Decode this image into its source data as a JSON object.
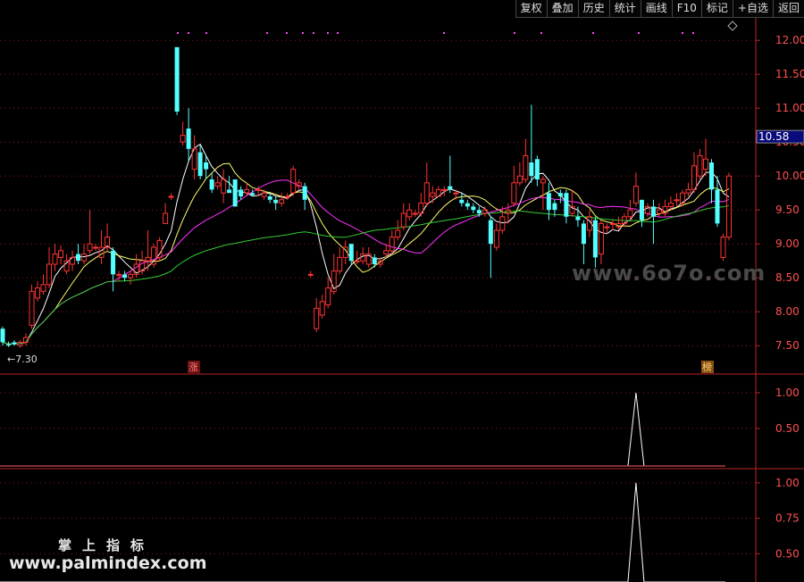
{
  "toolbar": {
    "items": [
      "复权",
      "叠加",
      "历史",
      "统计",
      "画线",
      "F10",
      "标记",
      "+自选",
      "返回"
    ]
  },
  "chart_data": {
    "type": "candlestick",
    "main_panel": {
      "y_ticks": [
        "12.00",
        "11.50",
        "11.00",
        "10.50",
        "10.00",
        "9.50",
        "9.00",
        "8.50",
        "8.00",
        "7.50"
      ],
      "ylim": [
        7.2,
        12.2
      ],
      "current_price_label": "10.58",
      "low_label": "←7.30",
      "marker_zhang": "涨",
      "marker_bang": "榜",
      "ma_colors": [
        "#ffffff",
        "#ffff66",
        "#ff33ff",
        "#33cc33"
      ],
      "candles": [
        [
          7.75,
          7.55,
          7.78,
          7.5
        ],
        [
          7.52,
          7.5,
          7.56,
          7.48
        ],
        [
          7.55,
          7.52,
          7.58,
          7.5
        ],
        [
          7.5,
          7.55,
          7.58,
          7.47
        ],
        [
          7.55,
          7.62,
          7.68,
          7.5
        ],
        [
          7.8,
          8.3,
          8.4,
          7.75
        ],
        [
          8.2,
          8.35,
          8.45,
          8.15
        ],
        [
          8.3,
          8.4,
          8.55,
          8.25
        ],
        [
          8.4,
          8.7,
          8.95,
          8.35
        ],
        [
          8.7,
          8.85,
          9.0,
          8.6
        ],
        [
          8.8,
          8.9,
          8.98,
          8.7
        ],
        [
          8.6,
          8.75,
          8.85,
          8.55
        ],
        [
          8.7,
          8.8,
          8.9,
          8.6
        ],
        [
          8.85,
          8.75,
          9.0,
          8.7
        ],
        [
          8.75,
          8.85,
          9.0,
          8.7
        ],
        [
          8.9,
          9.0,
          9.5,
          8.85
        ],
        [
          8.95,
          8.95,
          9.0,
          8.9
        ],
        [
          8.8,
          8.95,
          9.2,
          8.7
        ],
        [
          8.95,
          9.1,
          9.3,
          8.9
        ],
        [
          8.9,
          8.55,
          8.95,
          8.3
        ],
        [
          8.55,
          8.55,
          8.6,
          8.45
        ],
        [
          8.55,
          8.5,
          8.6,
          8.45
        ],
        [
          8.5,
          8.55,
          8.6,
          8.4
        ],
        [
          8.55,
          8.7,
          8.85,
          8.5
        ],
        [
          8.6,
          8.75,
          8.9,
          8.55
        ],
        [
          8.75,
          8.8,
          9.2,
          8.6
        ],
        [
          8.7,
          8.95,
          9.0,
          8.65
        ],
        [
          8.8,
          9.05,
          9.1,
          8.75
        ],
        [
          9.3,
          9.45,
          9.6,
          9.3
        ],
        [
          9.7,
          9.7,
          9.75,
          9.65
        ],
        [
          11.9,
          10.95,
          11.9,
          10.9
        ],
        [
          10.5,
          10.6,
          10.8,
          10.45
        ],
        [
          10.7,
          10.4,
          11.0,
          10.2
        ],
        [
          10.1,
          10.4,
          10.6,
          9.95
        ],
        [
          10.35,
          10.0,
          10.45,
          9.95
        ],
        [
          10.2,
          10.1,
          10.3,
          9.95
        ],
        [
          9.95,
          9.8,
          10.05,
          9.75
        ],
        [
          9.85,
          9.9,
          10.0,
          9.8
        ],
        [
          9.75,
          9.95,
          10.1,
          9.6
        ],
        [
          9.8,
          9.75,
          10.0,
          9.75
        ],
        [
          9.95,
          9.55,
          9.95,
          9.55
        ],
        [
          9.8,
          9.7,
          9.85,
          9.65
        ],
        [
          9.75,
          9.8,
          9.9,
          9.7
        ],
        [
          9.75,
          9.72,
          9.8,
          9.7
        ],
        [
          9.8,
          9.8,
          9.85,
          9.7
        ],
        [
          9.7,
          9.75,
          9.8,
          9.65
        ],
        [
          9.7,
          9.65,
          9.75,
          9.6
        ],
        [
          9.65,
          9.6,
          9.7,
          9.5
        ],
        [
          9.6,
          9.65,
          9.75,
          9.55
        ],
        [
          9.7,
          9.7,
          9.75,
          9.65
        ],
        [
          9.75,
          10.1,
          10.15,
          9.7
        ],
        [
          9.85,
          9.9,
          9.95,
          9.8
        ],
        [
          9.85,
          9.65,
          9.9,
          9.5
        ],
        [
          8.55,
          8.55,
          8.6,
          8.5
        ],
        [
          7.75,
          8.05,
          8.2,
          7.7
        ],
        [
          7.95,
          8.15,
          8.25,
          7.9
        ],
        [
          8.1,
          8.35,
          8.5,
          8.05
        ],
        [
          8.3,
          8.6,
          8.85,
          8.25
        ],
        [
          8.6,
          8.8,
          8.95,
          8.55
        ],
        [
          8.8,
          8.95,
          9.05,
          8.7
        ],
        [
          9.0,
          8.75,
          9.0,
          8.7
        ],
        [
          8.75,
          8.75,
          8.9,
          8.7
        ],
        [
          8.75,
          8.85,
          8.95,
          8.7
        ],
        [
          8.7,
          8.85,
          8.95,
          8.65
        ],
        [
          8.8,
          8.7,
          8.85,
          8.65
        ],
        [
          8.7,
          8.75,
          8.8,
          8.65
        ],
        [
          8.85,
          8.9,
          9.0,
          8.8
        ],
        [
          8.9,
          9.1,
          9.2,
          8.85
        ],
        [
          9.1,
          9.2,
          9.35,
          9.05
        ],
        [
          9.25,
          9.45,
          9.6,
          9.2
        ],
        [
          9.4,
          9.5,
          9.6,
          9.35
        ],
        [
          9.45,
          9.45,
          9.5,
          9.4
        ],
        [
          9.45,
          9.6,
          9.75,
          9.4
        ],
        [
          9.6,
          9.9,
          10.2,
          9.55
        ],
        [
          9.7,
          9.75,
          9.85,
          9.6
        ],
        [
          9.7,
          9.8,
          9.85,
          9.7
        ],
        [
          9.8,
          9.8,
          9.85,
          9.7
        ],
        [
          9.85,
          9.8,
          10.3,
          9.75
        ],
        [
          9.75,
          9.75,
          9.8,
          9.65
        ],
        [
          9.65,
          9.6,
          9.75,
          9.55
        ],
        [
          9.6,
          9.55,
          9.65,
          9.5
        ],
        [
          9.55,
          9.5,
          9.6,
          9.45
        ],
        [
          9.5,
          9.45,
          9.55,
          9.4
        ],
        [
          9.45,
          9.5,
          9.55,
          9.4
        ],
        [
          9.35,
          9.0,
          9.4,
          8.5
        ],
        [
          8.95,
          9.2,
          9.3,
          8.9
        ],
        [
          9.2,
          9.4,
          9.55,
          9.15
        ],
        [
          9.45,
          9.5,
          9.6,
          9.3
        ],
        [
          9.6,
          9.9,
          10.15,
          9.55
        ],
        [
          9.9,
          10.0,
          10.2,
          9.85
        ],
        [
          9.95,
          10.3,
          10.55,
          9.9
        ],
        [
          10.2,
          10.0,
          11.05,
          9.9
        ],
        [
          10.25,
          9.95,
          10.3,
          9.85
        ],
        [
          9.9,
          9.95,
          10.0,
          9.5
        ],
        [
          9.75,
          9.5,
          9.9,
          9.35
        ],
        [
          9.6,
          9.5,
          9.65,
          9.4
        ],
        [
          9.75,
          9.7,
          9.8,
          9.6
        ],
        [
          9.75,
          9.4,
          9.8,
          9.3
        ],
        [
          9.45,
          9.55,
          9.8,
          9.4
        ],
        [
          9.4,
          9.35,
          9.55,
          9.25
        ],
        [
          9.3,
          9.0,
          9.35,
          8.7
        ],
        [
          9.2,
          9.4,
          9.5,
          9.1
        ],
        [
          9.35,
          8.8,
          9.4,
          8.65
        ],
        [
          8.85,
          9.3,
          9.35,
          8.7
        ],
        [
          9.25,
          9.25,
          9.3,
          9.15
        ],
        [
          9.3,
          9.3,
          9.35,
          9.2
        ],
        [
          9.25,
          9.3,
          9.4,
          9.2
        ],
        [
          9.3,
          9.4,
          9.45,
          9.25
        ],
        [
          9.4,
          9.5,
          9.65,
          9.35
        ],
        [
          9.6,
          9.85,
          10.05,
          9.55
        ],
        [
          9.65,
          9.35,
          9.65,
          9.25
        ],
        [
          9.45,
          9.55,
          9.6,
          9.4
        ],
        [
          9.55,
          9.4,
          9.65,
          9.0
        ],
        [
          9.45,
          9.5,
          9.6,
          9.4
        ],
        [
          9.45,
          9.55,
          9.65,
          9.4
        ],
        [
          9.55,
          9.6,
          9.7,
          9.5
        ],
        [
          9.65,
          9.65,
          9.75,
          9.55
        ],
        [
          9.6,
          9.75,
          9.8,
          9.55
        ],
        [
          9.75,
          9.8,
          9.9,
          9.7
        ],
        [
          9.8,
          10.15,
          10.35,
          9.75
        ],
        [
          10.0,
          10.3,
          10.4,
          9.95
        ],
        [
          10.1,
          10.25,
          10.55,
          10.0
        ],
        [
          10.2,
          9.8,
          10.25,
          9.6
        ],
        [
          9.8,
          9.3,
          10.0,
          9.25
        ],
        [
          8.8,
          9.1,
          9.15,
          8.75
        ],
        [
          9.1,
          10.0,
          10.05,
          9.05
        ]
      ]
    },
    "indicator_1": {
      "y_ticks": [
        "1.00",
        "0.50"
      ],
      "ylim": [
        0,
        1.15
      ],
      "spike_index": 109
    },
    "indicator_2": {
      "y_ticks": [
        "1.00",
        "0.75",
        "0.50"
      ],
      "ylim": [
        0.3,
        1.05
      ],
      "spike_index": 109
    },
    "candle_colors": {
      "up": "#ff3333",
      "down": "#54ffff"
    }
  },
  "watermarks": {
    "brand_cn": "掌上指标",
    "brand_url": "www.palmindex.com",
    "ghost": "www.6o7o.com"
  }
}
